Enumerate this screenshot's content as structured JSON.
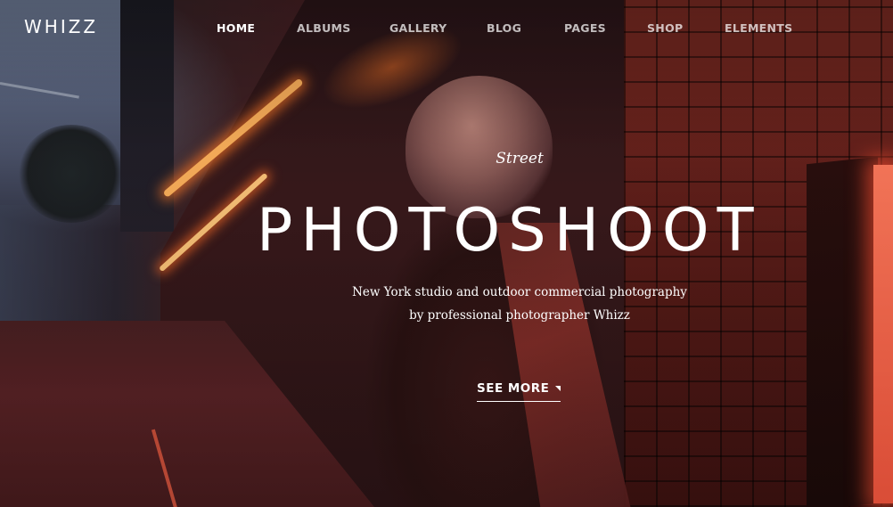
{
  "brand": {
    "logo": "WHIZZ"
  },
  "nav": {
    "items": [
      {
        "label": "HOME",
        "active": true
      },
      {
        "label": "ALBUMS",
        "active": false
      },
      {
        "label": "GALLERY",
        "active": false
      },
      {
        "label": "BLOG",
        "active": false
      },
      {
        "label": "PAGES",
        "active": false
      },
      {
        "label": "SHOP",
        "active": false
      },
      {
        "label": "ELEMENTS",
        "active": false
      }
    ]
  },
  "hero": {
    "kicker": "Street",
    "headline": "PHOTOSHOOT",
    "subtitle_line1": "New York studio and outdoor commercial photography",
    "subtitle_line2": "by professional photographer Whizz",
    "cta_label": "SEE MORE",
    "cta_icon": "caret-down-icon"
  },
  "colors": {
    "text": "#ffffff",
    "neon": "#ff8a3c",
    "brick": "#6a1e1a"
  }
}
